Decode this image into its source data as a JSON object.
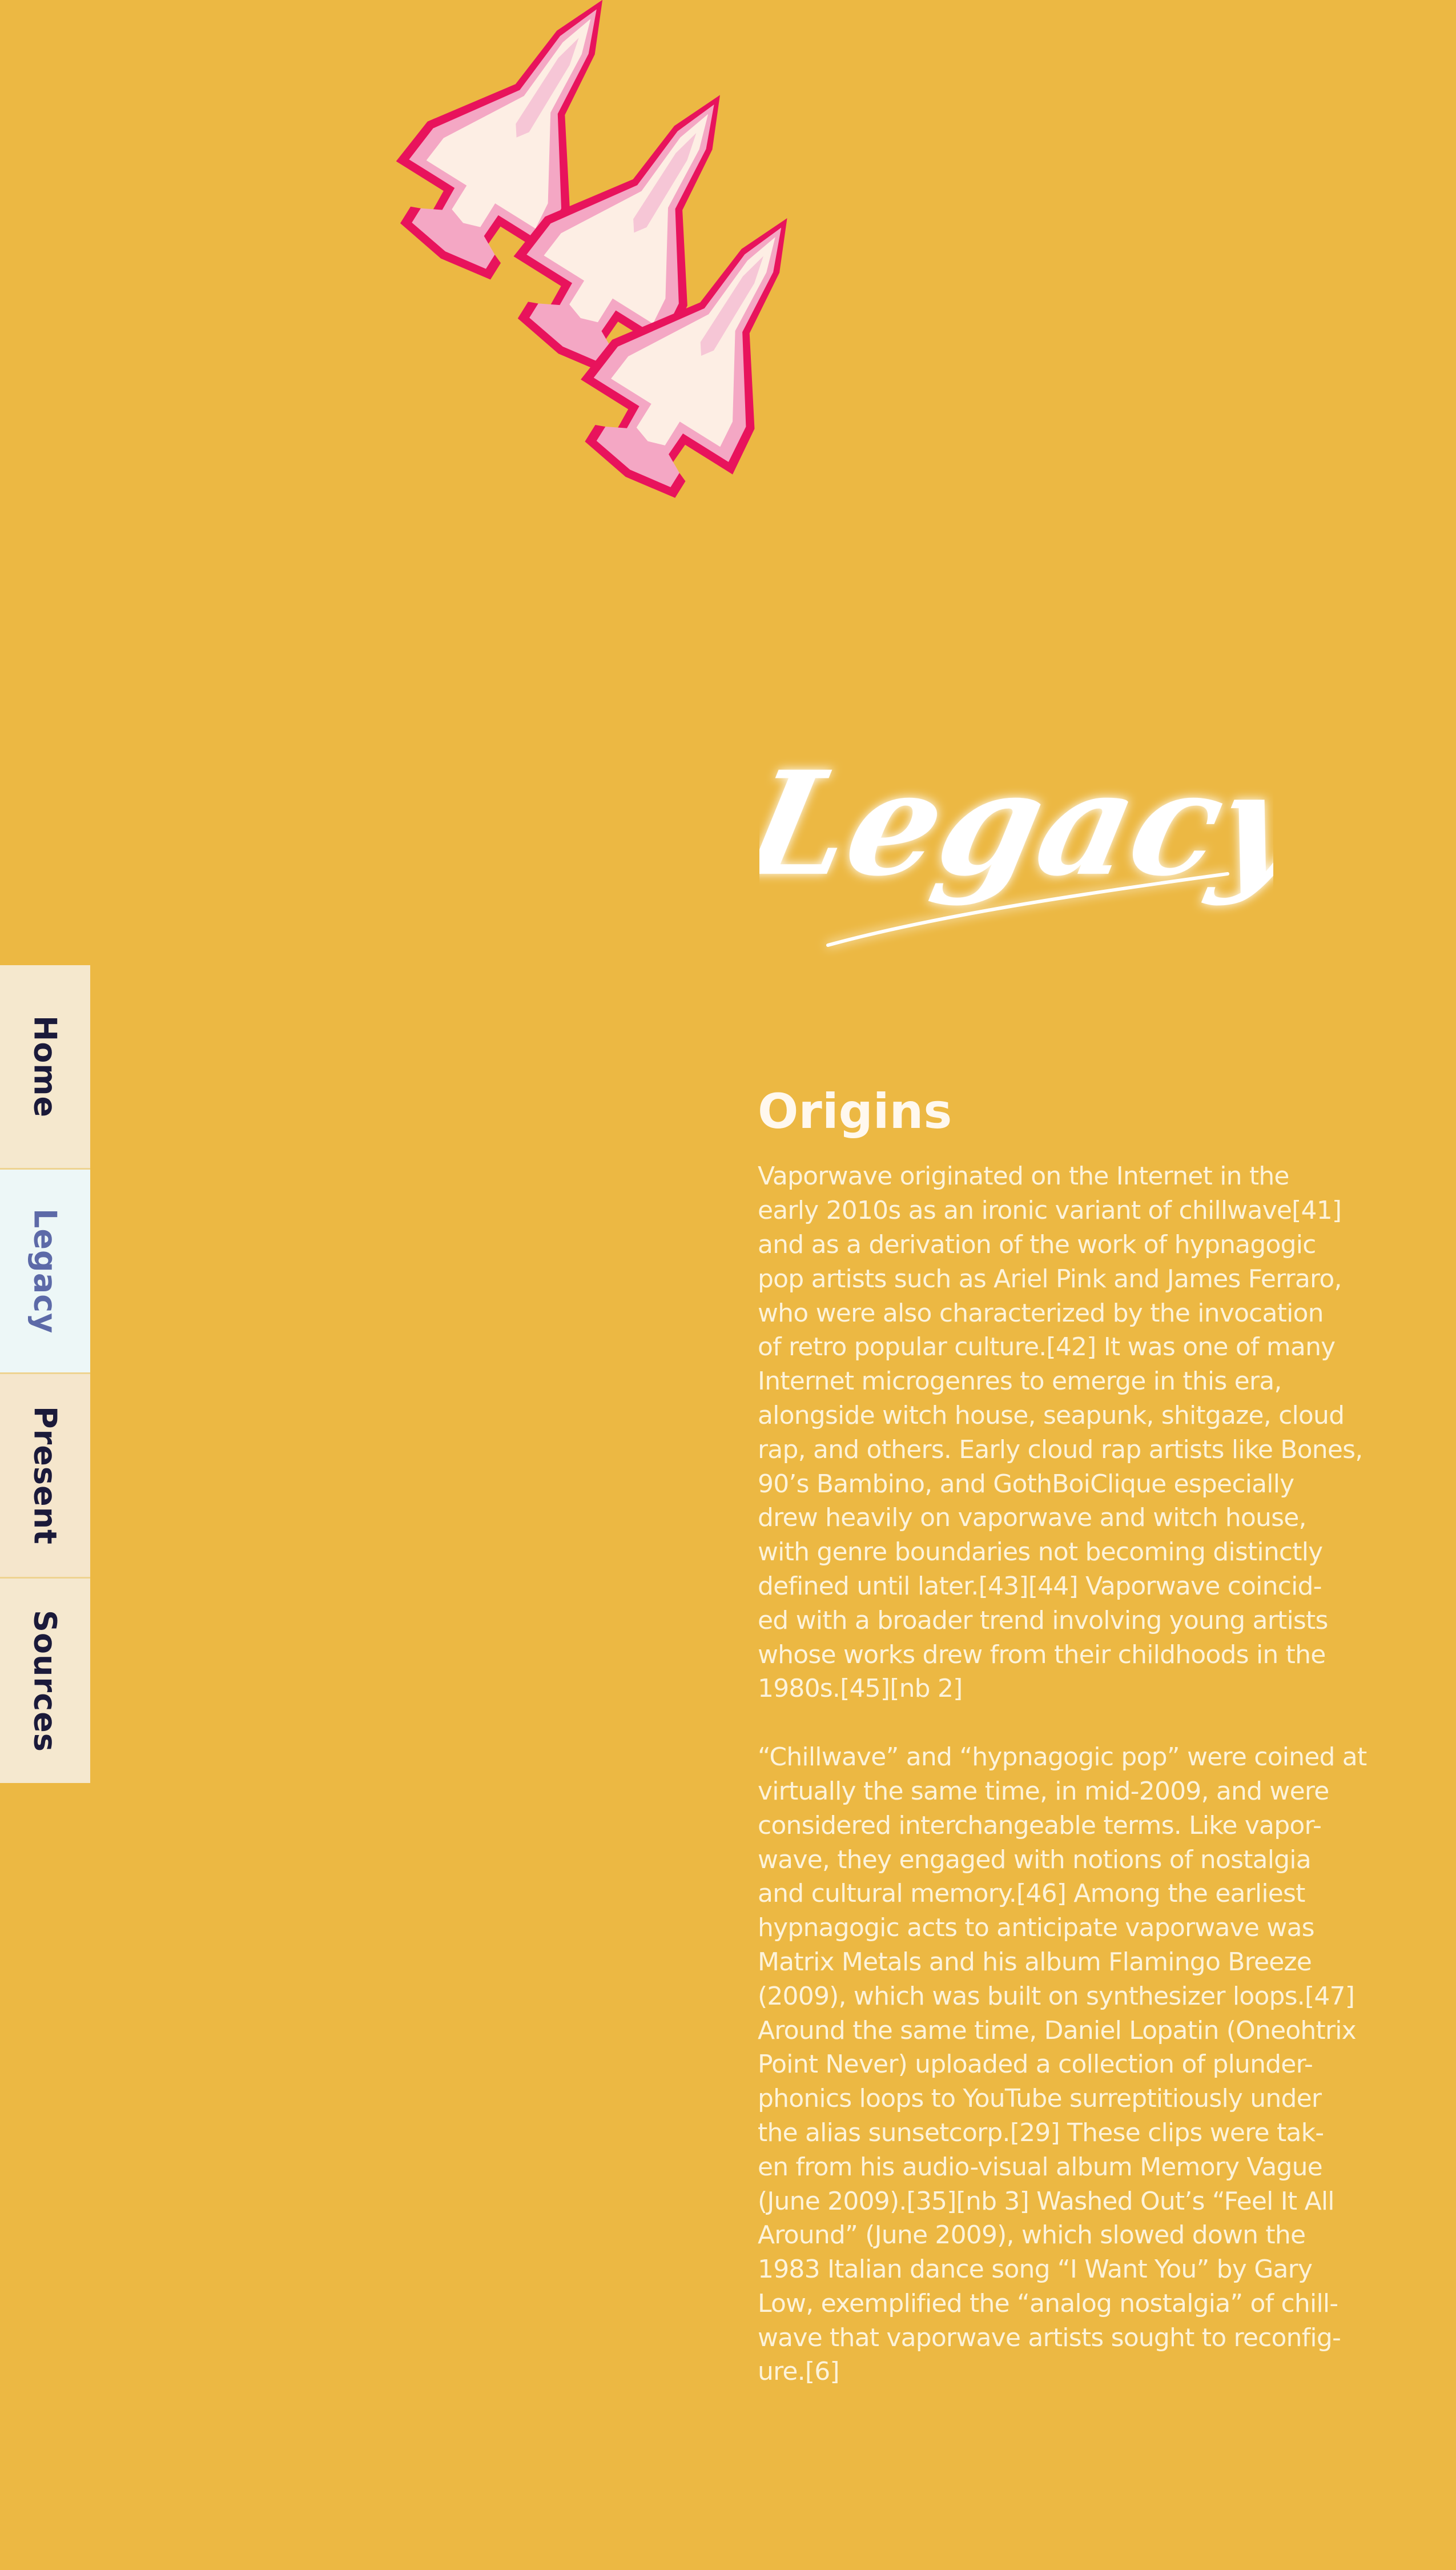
{
  "page": {
    "background": "#ecb843",
    "art_icon": "pixel-space-shuttles"
  },
  "hero": {
    "title": "Legacy"
  },
  "nav": {
    "items": [
      {
        "label": "Home"
      },
      {
        "label": "Legacy",
        "active": true
      },
      {
        "label": "Present"
      },
      {
        "label": "Sources"
      }
    ],
    "active_color": "#5d6aa8",
    "text_color": "#1b1a3a"
  },
  "section": {
    "heading": "Origins",
    "paragraphs": [
      "Vaporwave originated on the Internet in the\nearly 2010s as an ironic variant of chillwave[41]\nand as a derivation of the work of hypnagogic\npop artists such as Ariel Pink and James Ferraro,\nwho were also characterized by the invocation\nof retro popular culture.[42] It was one of many\nInternet microgenres to emerge in this era,\nalongside witch house, seapunk, shitgaze, cloud\nrap, and others. Early cloud rap artists like Bones,\n90’s Bambino, and GothBoiClique especially\ndrew heavily on vaporwave and witch house,\nwith genre boundaries not becoming distinctly\ndefined until later.[43][44] Vaporwave coincid-\ned with a broader trend involving young artists\nwhose works drew from their childhoods in the\n1980s.[45][nb 2]",
      "“Chillwave” and “hypnagogic pop” were coined at\nvirtually the same time, in mid-2009, and were\nconsidered interchangeable terms. Like vapor-\nwave, they engaged with notions of nostalgia\nand cultural memory.[46] Among the earliest\nhypnagogic acts to anticipate vaporwave was\nMatrix Metals and his album Flamingo Breeze\n(2009), which was built on synthesizer loops.[47]\nAround the same time, Daniel Lopatin (Oneohtrix\nPoint Never) uploaded a collection of plunder-\nphonics loops to YouTube surreptitiously under\nthe alias sunsetcorp.[29] These clips were tak-\nen from his audio-visual album Memory Vague\n(June 2009).[35][nb 3] Washed Out’s “Feel It All\nAround” (June 2009), which slowed down the\n1983 Italian dance song “I Want You” by Gary\nLow, exemplified the “analog nostalgia” of chill-\nwave that vaporwave artists sought to reconfig-\nure.[6]"
    ]
  }
}
